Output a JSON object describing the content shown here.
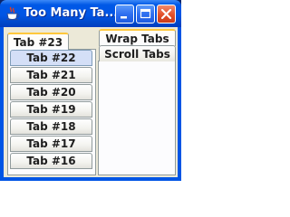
{
  "window": {
    "title": "Too Many Ta...",
    "controls": {
      "minimize": "minimize-icon",
      "maximize": "maximize-icon",
      "close": "close-icon"
    }
  },
  "colors": {
    "titlebar": "#0055e5",
    "client_background": "#ece9d8",
    "selected_tab_highlight": "#ffc83c",
    "selected_list_item": "#d4dff7"
  },
  "top_tabs": [
    {
      "label": "Wrap Tabs",
      "selected": true
    },
    {
      "label": "Scroll Tabs",
      "selected": false
    }
  ],
  "inner_tabs": [
    {
      "label": "Tab #23",
      "selected": true
    },
    {
      "label": "Tab #22",
      "selected": true
    },
    {
      "label": "Tab #21",
      "selected": false
    },
    {
      "label": "Tab #20",
      "selected": false
    },
    {
      "label": "Tab #19",
      "selected": false
    },
    {
      "label": "Tab #18",
      "selected": false
    },
    {
      "label": "Tab #17",
      "selected": false
    },
    {
      "label": "Tab #16",
      "selected": false
    }
  ]
}
